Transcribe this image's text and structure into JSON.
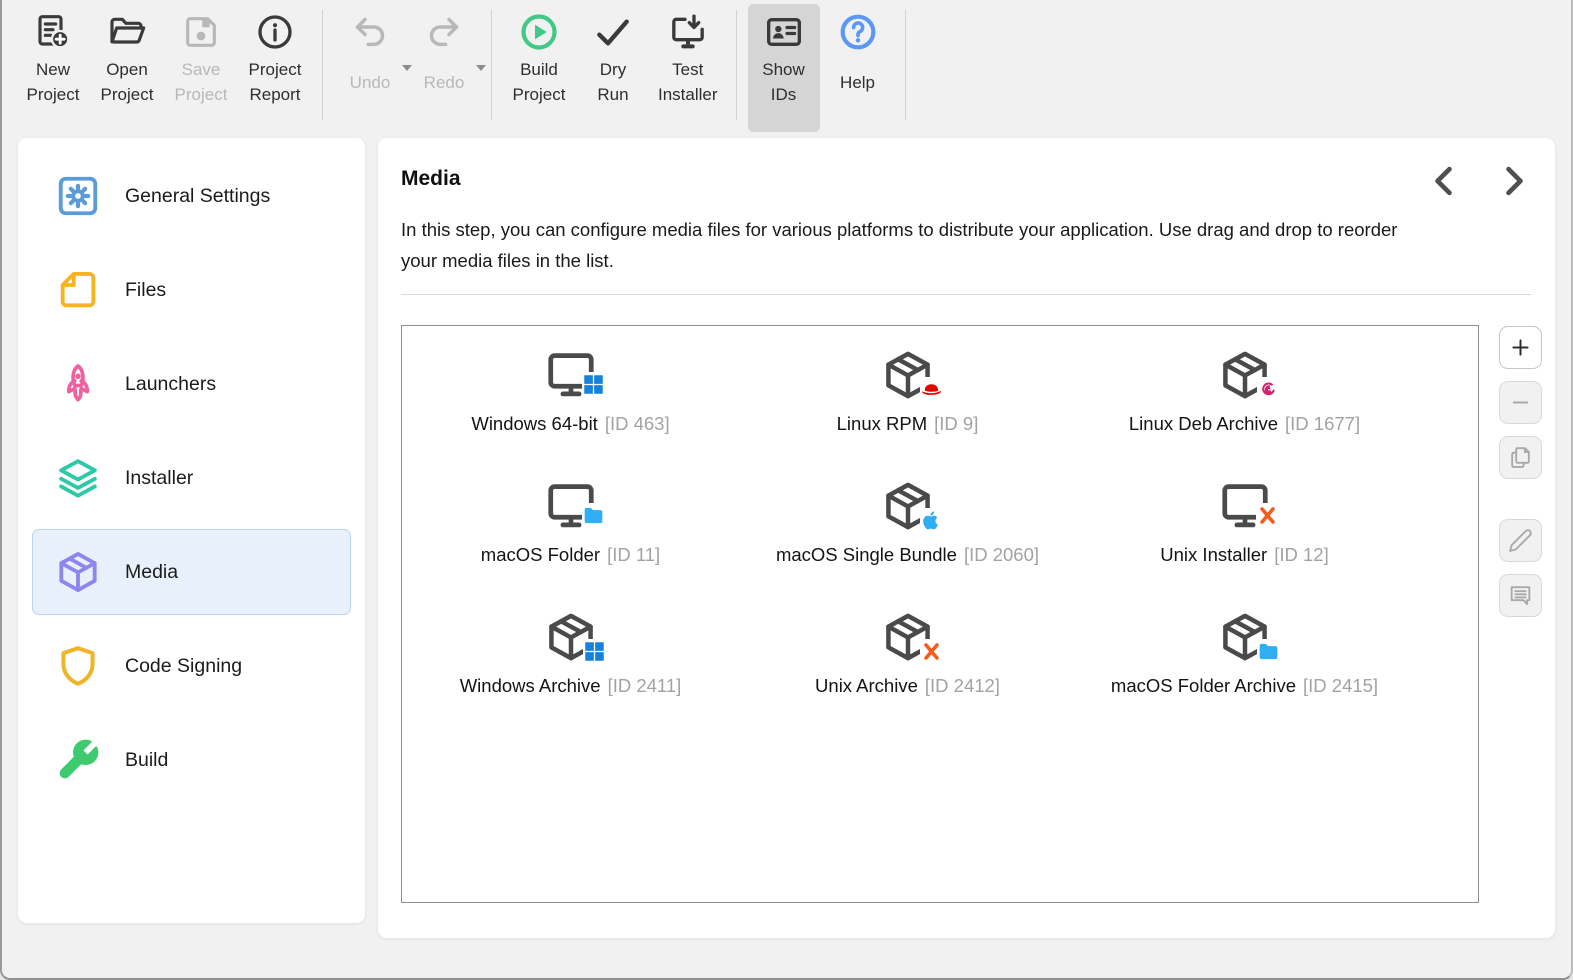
{
  "toolbar": {
    "groups": [
      [
        {
          "name": "new-project",
          "label": "New\nProject",
          "icon": "new-project",
          "enabled": true
        },
        {
          "name": "open-project",
          "label": "Open\nProject",
          "icon": "open-project",
          "enabled": true
        },
        {
          "name": "save-project",
          "label": "Save\nProject",
          "icon": "save-project",
          "enabled": false
        },
        {
          "name": "project-report",
          "label": "Project\nReport",
          "icon": "project-report",
          "enabled": true
        }
      ],
      [
        {
          "name": "undo",
          "label": "Undo",
          "icon": "undo",
          "enabled": false,
          "dropdown": true
        },
        {
          "name": "redo",
          "label": "Redo",
          "icon": "redo",
          "enabled": false,
          "dropdown": true
        }
      ],
      [
        {
          "name": "build-project",
          "label": "Build\nProject",
          "icon": "build-project",
          "enabled": true,
          "icon_color": "#41c987"
        },
        {
          "name": "dry-run",
          "label": "Dry\nRun",
          "icon": "dry-run",
          "enabled": true
        },
        {
          "name": "test-installer",
          "label": "Test\nInstaller",
          "icon": "test-installer",
          "enabled": true
        }
      ],
      [
        {
          "name": "show-ids",
          "label": "Show\nIDs",
          "icon": "show-ids",
          "enabled": true,
          "toggled": true
        },
        {
          "name": "help",
          "label": "Help",
          "icon": "help",
          "enabled": true,
          "icon_color": "#5b97f5"
        }
      ]
    ]
  },
  "sidebar": {
    "items": [
      {
        "name": "general-settings",
        "label": "General Settings",
        "icon": "general-settings",
        "color": "#5b9bd8",
        "selected": false
      },
      {
        "name": "files",
        "label": "Files",
        "icon": "files",
        "color": "#f6b51e",
        "selected": false
      },
      {
        "name": "launchers",
        "label": "Launchers",
        "icon": "launchers",
        "color": "#f0609e",
        "selected": false
      },
      {
        "name": "installer",
        "label": "Installer",
        "icon": "installer",
        "color": "#2bc9a8",
        "selected": false
      },
      {
        "name": "media",
        "label": "Media",
        "icon": "package",
        "color": "#8f85ea",
        "selected": true
      },
      {
        "name": "code-signing",
        "label": "Code Signing",
        "icon": "code-signing",
        "color": "#f0b429",
        "selected": false
      },
      {
        "name": "build",
        "label": "Build",
        "icon": "build",
        "color": "#3ecb70",
        "selected": false
      }
    ]
  },
  "main": {
    "title": "Media",
    "description": "In this step, you can configure media files for various platforms to distribute your application. Use drag and drop to reorder your media files in the list.",
    "media_items": [
      {
        "name": "Windows 64-bit",
        "id_label": "[ID 463]",
        "base": "monitor",
        "badge": "windows"
      },
      {
        "name": "Linux RPM",
        "id_label": "[ID 9]",
        "base": "package",
        "badge": "redhat"
      },
      {
        "name": "Linux Deb Archive",
        "id_label": "[ID 1677]",
        "base": "package",
        "badge": "debian"
      },
      {
        "name": "macOS Folder",
        "id_label": "[ID 11]",
        "base": "monitor",
        "badge": "folder"
      },
      {
        "name": "macOS Single Bundle",
        "id_label": "[ID 2060]",
        "base": "package",
        "badge": "apple"
      },
      {
        "name": "Unix Installer",
        "id_label": "[ID 12]",
        "base": "monitor",
        "badge": "x-mark"
      },
      {
        "name": "Windows Archive",
        "id_label": "[ID 2411]",
        "base": "package",
        "badge": "windows"
      },
      {
        "name": "Unix Archive",
        "id_label": "[ID 2412]",
        "base": "package",
        "badge": "x-mark"
      },
      {
        "name": "macOS Folder Archive",
        "id_label": "[ID 2415]",
        "base": "package",
        "badge": "folder"
      }
    ],
    "tools": [
      {
        "name": "add",
        "icon": "plus",
        "enabled": true
      },
      {
        "name": "remove",
        "icon": "minus",
        "enabled": false
      },
      {
        "name": "duplicate",
        "icon": "duplicate",
        "enabled": false
      },
      {
        "name": "edit",
        "icon": "edit-pencil",
        "enabled": false,
        "gap_before": true
      },
      {
        "name": "comment",
        "icon": "comment",
        "enabled": false
      }
    ]
  },
  "colors": {
    "window_background": "#f1f1f1",
    "toggled_button_background": "#d5d5d5",
    "sidebar_selected_bg": "#e7f0fb",
    "sidebar_selected_border": "#bad5f1",
    "media_base_icon": "#4a4a4a",
    "id_text": "#a2a2a2",
    "badge": {
      "windows": "#1581d8",
      "redhat": "#e60000",
      "debian": "#d4206e",
      "folder": "#30aef3",
      "apple": "#30aef3",
      "x-mark": "#f25c1c"
    }
  }
}
